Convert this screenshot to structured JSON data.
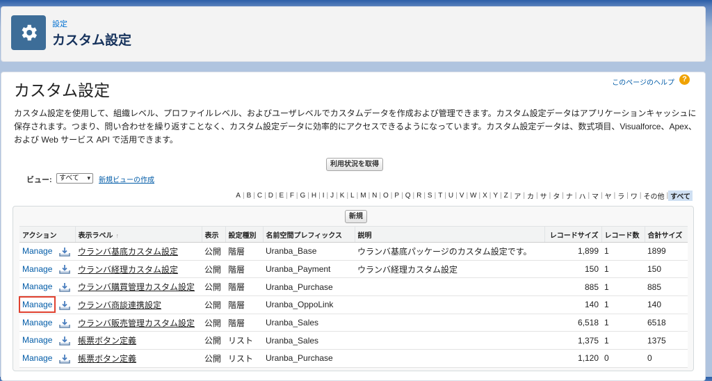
{
  "header": {
    "breadcrumb": "設定",
    "title": "カスタム設定",
    "icon": "gear-icon"
  },
  "page": {
    "title": "カスタム設定",
    "help_link": "このページのヘルプ",
    "help_icon": "?",
    "description": "カスタム設定を使用して、組織レベル、プロファイルレベル、およびユーザレベルでカスタムデータを作成および管理できます。カスタム設定データはアプリケーションキャッシュに保存されます。つまり、問い合わせを繰り返すことなく、カスタム設定データに効率的にアクセスできるようになっています。カスタム設定データは、数式項目、Visualforce、Apex、および Web サービス API で活用できます。",
    "usage_button": "利用状況を取得"
  },
  "view": {
    "label": "ビュー:",
    "selected": "すべて",
    "new_view_link": "新規ビューの作成"
  },
  "alpha_filter": [
    "A",
    "B",
    "C",
    "D",
    "E",
    "F",
    "G",
    "H",
    "I",
    "J",
    "K",
    "L",
    "M",
    "N",
    "O",
    "P",
    "Q",
    "R",
    "S",
    "T",
    "U",
    "V",
    "W",
    "X",
    "Y",
    "Z",
    "ア",
    "カ",
    "サ",
    "タ",
    "ナ",
    "ハ",
    "マ",
    "ヤ",
    "ラ",
    "ワ",
    "その他",
    "すべて"
  ],
  "alpha_selected": "すべて",
  "list": {
    "new_button": "新規",
    "columns": {
      "action": "アクション",
      "label": "表示ラベル",
      "sort_indicator": "↑",
      "visibility": "表示",
      "type": "設定種別",
      "prefix": "名前空間プレフィックス",
      "description": "説明",
      "record_size": "レコードサイズ",
      "record_count": "レコード数",
      "total_size": "合計サイズ"
    },
    "rows": [
      {
        "action": "Manage",
        "label": "ウランバ基底カスタム設定",
        "visibility": "公開",
        "type": "階層",
        "prefix": "Uranba_Base",
        "description": "ウランバ基底パッケージのカスタム設定です。",
        "record_size": "1,899",
        "record_count": "1",
        "total_size": "1899"
      },
      {
        "action": "Manage",
        "label": "ウランバ経理カスタム設定",
        "visibility": "公開",
        "type": "階層",
        "prefix": "Uranba_Payment",
        "description": "ウランバ経理カスタム設定",
        "record_size": "150",
        "record_count": "1",
        "total_size": "150"
      },
      {
        "action": "Manage",
        "label": "ウランバ購買管理カスタム設定",
        "visibility": "公開",
        "type": "階層",
        "prefix": "Uranba_Purchase",
        "description": "",
        "record_size": "885",
        "record_count": "1",
        "total_size": "885"
      },
      {
        "action": "Manage",
        "label": "ウランバ商談連携設定",
        "visibility": "公開",
        "type": "階層",
        "prefix": "Uranba_OppoLink",
        "description": "",
        "record_size": "140",
        "record_count": "1",
        "total_size": "140"
      },
      {
        "action": "Manage",
        "label": "ウランバ販売管理カスタム設定",
        "visibility": "公開",
        "type": "階層",
        "prefix": "Uranba_Sales",
        "description": "",
        "record_size": "6,518",
        "record_count": "1",
        "total_size": "6518"
      },
      {
        "action": "Manage",
        "label": "帳票ボタン定義",
        "visibility": "公開",
        "type": "リスト",
        "prefix": "Uranba_Sales",
        "description": "",
        "record_size": "1,375",
        "record_count": "1",
        "total_size": "1375"
      },
      {
        "action": "Manage",
        "label": "帳票ボタン定義",
        "visibility": "公開",
        "type": "リスト",
        "prefix": "Uranba_Purchase",
        "description": "",
        "record_size": "1,120",
        "record_count": "0",
        "total_size": "0"
      }
    ],
    "highlighted_row": 3,
    "row_icon": "export-icon"
  }
}
